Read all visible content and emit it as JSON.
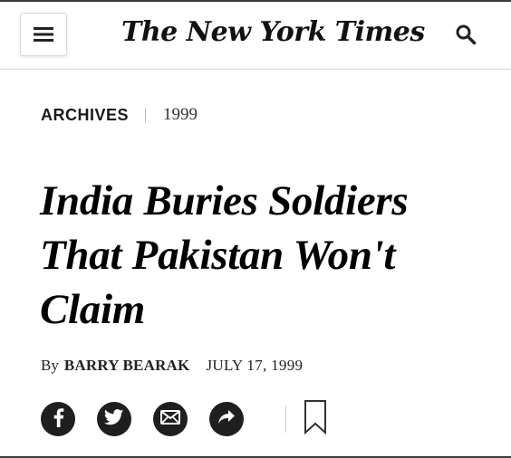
{
  "header": {
    "logo_text": "The New York Times",
    "menu_icon": "hamburger-menu-icon",
    "search_icon": "search-icon"
  },
  "kicker": {
    "section": "ARCHIVES",
    "year": "1999"
  },
  "article": {
    "headline": "India Buries Soldiers That Pakistan Won't Claim",
    "byline_prefix": "By",
    "author": "BARRY BEARAK",
    "date": "JULY 17, 1999"
  },
  "share_tools": [
    {
      "name": "facebook",
      "icon": "facebook-icon"
    },
    {
      "name": "twitter",
      "icon": "twitter-icon"
    },
    {
      "name": "email",
      "icon": "email-icon"
    },
    {
      "name": "share",
      "icon": "share-arrow-icon"
    },
    {
      "name": "save",
      "icon": "bookmark-icon"
    }
  ],
  "colors": {
    "text": "#121212",
    "icon_fill": "#1f1f1f",
    "divider": "#d6d6d6"
  }
}
